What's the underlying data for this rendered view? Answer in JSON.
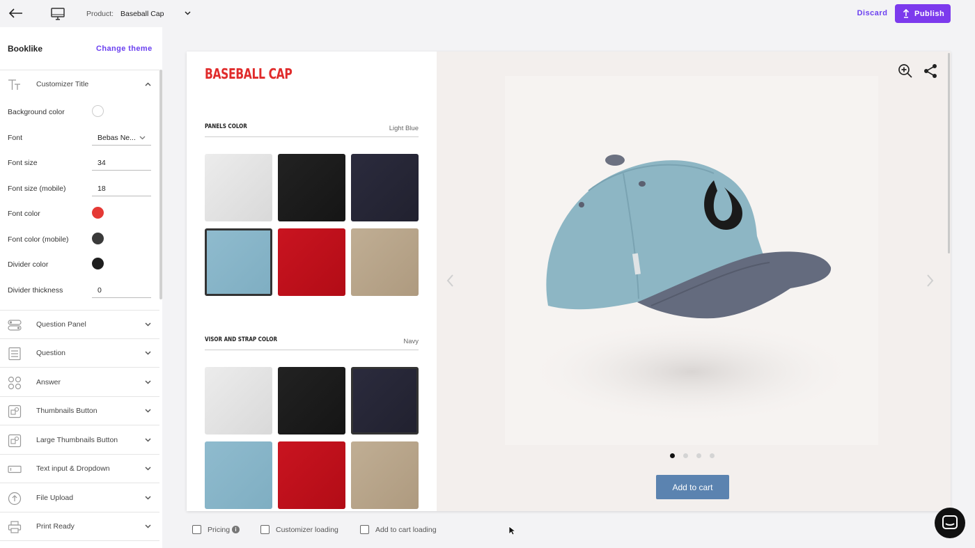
{
  "topbar": {
    "product_label": "Product:",
    "product_value": "Baseball Cap",
    "discard_label": "Discard",
    "publish_label": "Publish"
  },
  "panel": {
    "theme_name": "Booklike",
    "change_theme_label": "Change theme",
    "expanded_section": "Customizer Title",
    "properties": {
      "background_color": {
        "label": "Background color",
        "color": "#ffffff"
      },
      "font": {
        "label": "Font",
        "value": "Bebas Ne..."
      },
      "font_size": {
        "label": "Font size",
        "value": "34"
      },
      "font_size_mobile": {
        "label": "Font size (mobile)",
        "value": "18"
      },
      "font_color": {
        "label": "Font color",
        "color": "#e53935"
      },
      "font_color_mobile": {
        "label": "Font color (mobile)",
        "color": "#3a3a3a"
      },
      "divider_color": {
        "label": "Divider color",
        "color": "#1f1f1f"
      },
      "divider_thickness": {
        "label": "Divider thickness",
        "value": "0"
      }
    },
    "sections": [
      {
        "label": "Question Panel",
        "icon": "toggle-panel-icon"
      },
      {
        "label": "Question",
        "icon": "list-lines-icon"
      },
      {
        "label": "Answer",
        "icon": "four-circles-icon"
      },
      {
        "label": "Thumbnails Button",
        "icon": "image-square-icon"
      },
      {
        "label": "Large Thumbnails Button",
        "icon": "image-square-icon"
      },
      {
        "label": "Text input & Dropdown",
        "icon": "text-input-icon"
      },
      {
        "label": "File Upload",
        "icon": "upload-circle-icon"
      },
      {
        "label": "Print Ready",
        "icon": "printer-icon"
      }
    ]
  },
  "preview": {
    "title": "BASEBALL CAP",
    "questions": [
      {
        "title": "PANELS COLOR",
        "value": "Light Blue"
      },
      {
        "title": "VISOR AND STRAP COLOR",
        "value": "Navy"
      }
    ],
    "swatch_colors": [
      "#e3e3e3",
      "#1c1c1c",
      "#262637",
      "#87b3c6",
      "#c0101a",
      "#b8a48a"
    ],
    "add_to_cart_label": "Add to cart",
    "gallery_dots": 4,
    "active_dot": 1
  },
  "bottom": {
    "pricing_label": "Pricing",
    "customizer_loading_label": "Customizer loading",
    "add_to_cart_loading_label": "Add to cart loading"
  }
}
